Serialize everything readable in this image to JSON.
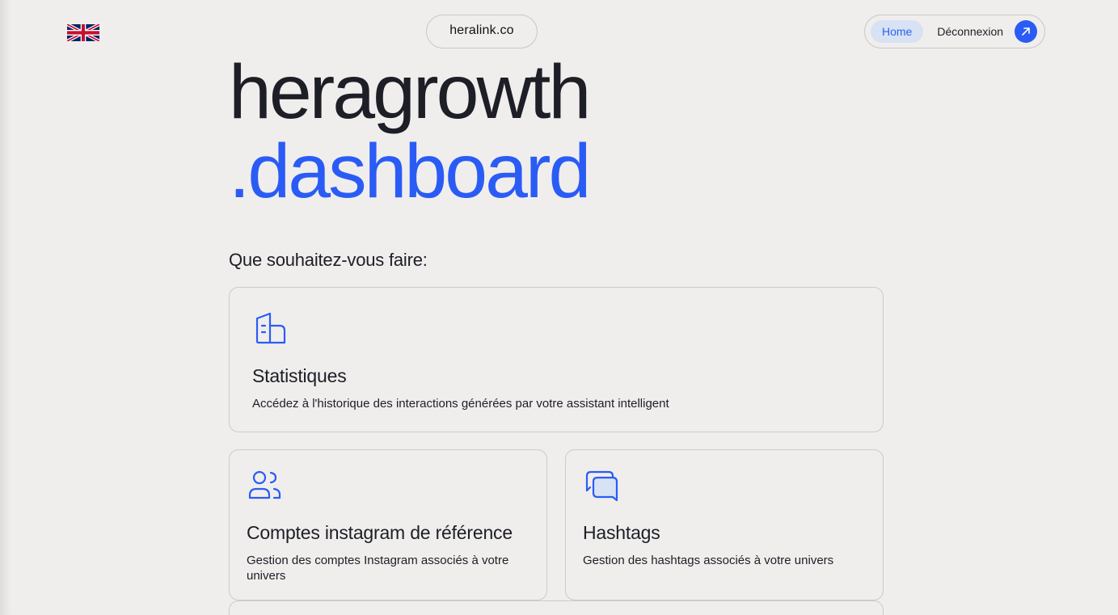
{
  "header": {
    "site_label": "heralink.co",
    "nav": {
      "home": "Home",
      "logout": "Déconnexion"
    }
  },
  "hero": {
    "line1": "heragrowth",
    "line2": ".dashboard"
  },
  "prompt": "Que souhaitez-vous faire:",
  "cards": [
    {
      "icon": "document-icon",
      "title": "Statistiques",
      "description": "Accédez à l'historique des interactions générées par votre assistant intelligent"
    },
    {
      "icon": "users-icon",
      "title": "Comptes instagram de référence",
      "description": "Gestion des comptes Instagram associés à votre univers"
    },
    {
      "icon": "chat-icon",
      "title": "Hashtags",
      "description": "Gestion des hashtags associés à votre univers"
    }
  ],
  "colors": {
    "background": "#f0eeed",
    "accent": "#2a5cf5",
    "text": "#1d1e26",
    "home_pill": "#d7e2f4"
  }
}
